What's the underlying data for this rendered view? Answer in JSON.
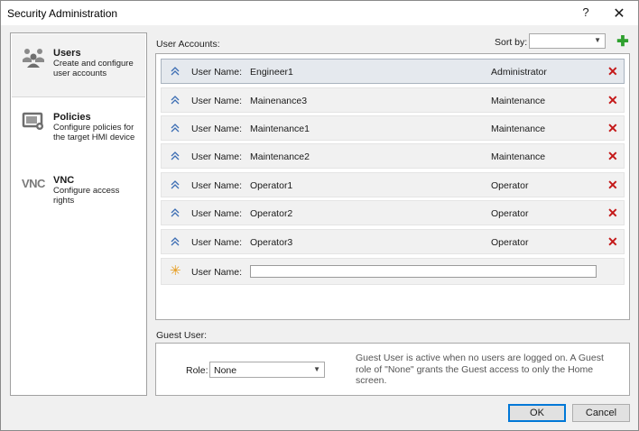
{
  "window": {
    "title": "Security Administration",
    "help_label": "?",
    "close_label": "✕"
  },
  "sidebar": {
    "items": [
      {
        "title": "Users",
        "desc": "Create and configure user accounts"
      },
      {
        "title": "Policies",
        "desc": "Configure policies for the target HMI device"
      },
      {
        "title": "VNC",
        "desc": "Configure access rights",
        "logo": "VNC"
      }
    ]
  },
  "accounts": {
    "label": "User Accounts:",
    "sort_label": "Sort by:",
    "sort_value": "",
    "add_icon": "plus-icon",
    "rows": [
      {
        "label": "User Name:",
        "name": "Engineer1",
        "role": "Administrator"
      },
      {
        "label": "User Name:",
        "name": "Mainenance3",
        "role": "Maintenance"
      },
      {
        "label": "User Name:",
        "name": "Maintenance1",
        "role": "Maintenance"
      },
      {
        "label": "User Name:",
        "name": "Maintenance2",
        "role": "Maintenance"
      },
      {
        "label": "User Name:",
        "name": "Operator1",
        "role": "Operator"
      },
      {
        "label": "User Name:",
        "name": "Operator2",
        "role": "Operator"
      },
      {
        "label": "User Name:",
        "name": "Operator3",
        "role": "Operator"
      }
    ],
    "new_row": {
      "label": "User Name:",
      "value": ""
    },
    "delete_icon": "✕"
  },
  "guest": {
    "label": "Guest User:",
    "role_label": "Role:",
    "role_value": "None",
    "note": "Guest User is active when no users are logged on. A Guest role of \"None\" grants the Guest access to only the Home screen."
  },
  "buttons": {
    "ok": "OK",
    "cancel": "Cancel"
  },
  "colors": {
    "delete": "#c41818",
    "add": "#2ea02e",
    "new_user_star": "#e69a1a",
    "selected_row": "#e5e9ee"
  }
}
